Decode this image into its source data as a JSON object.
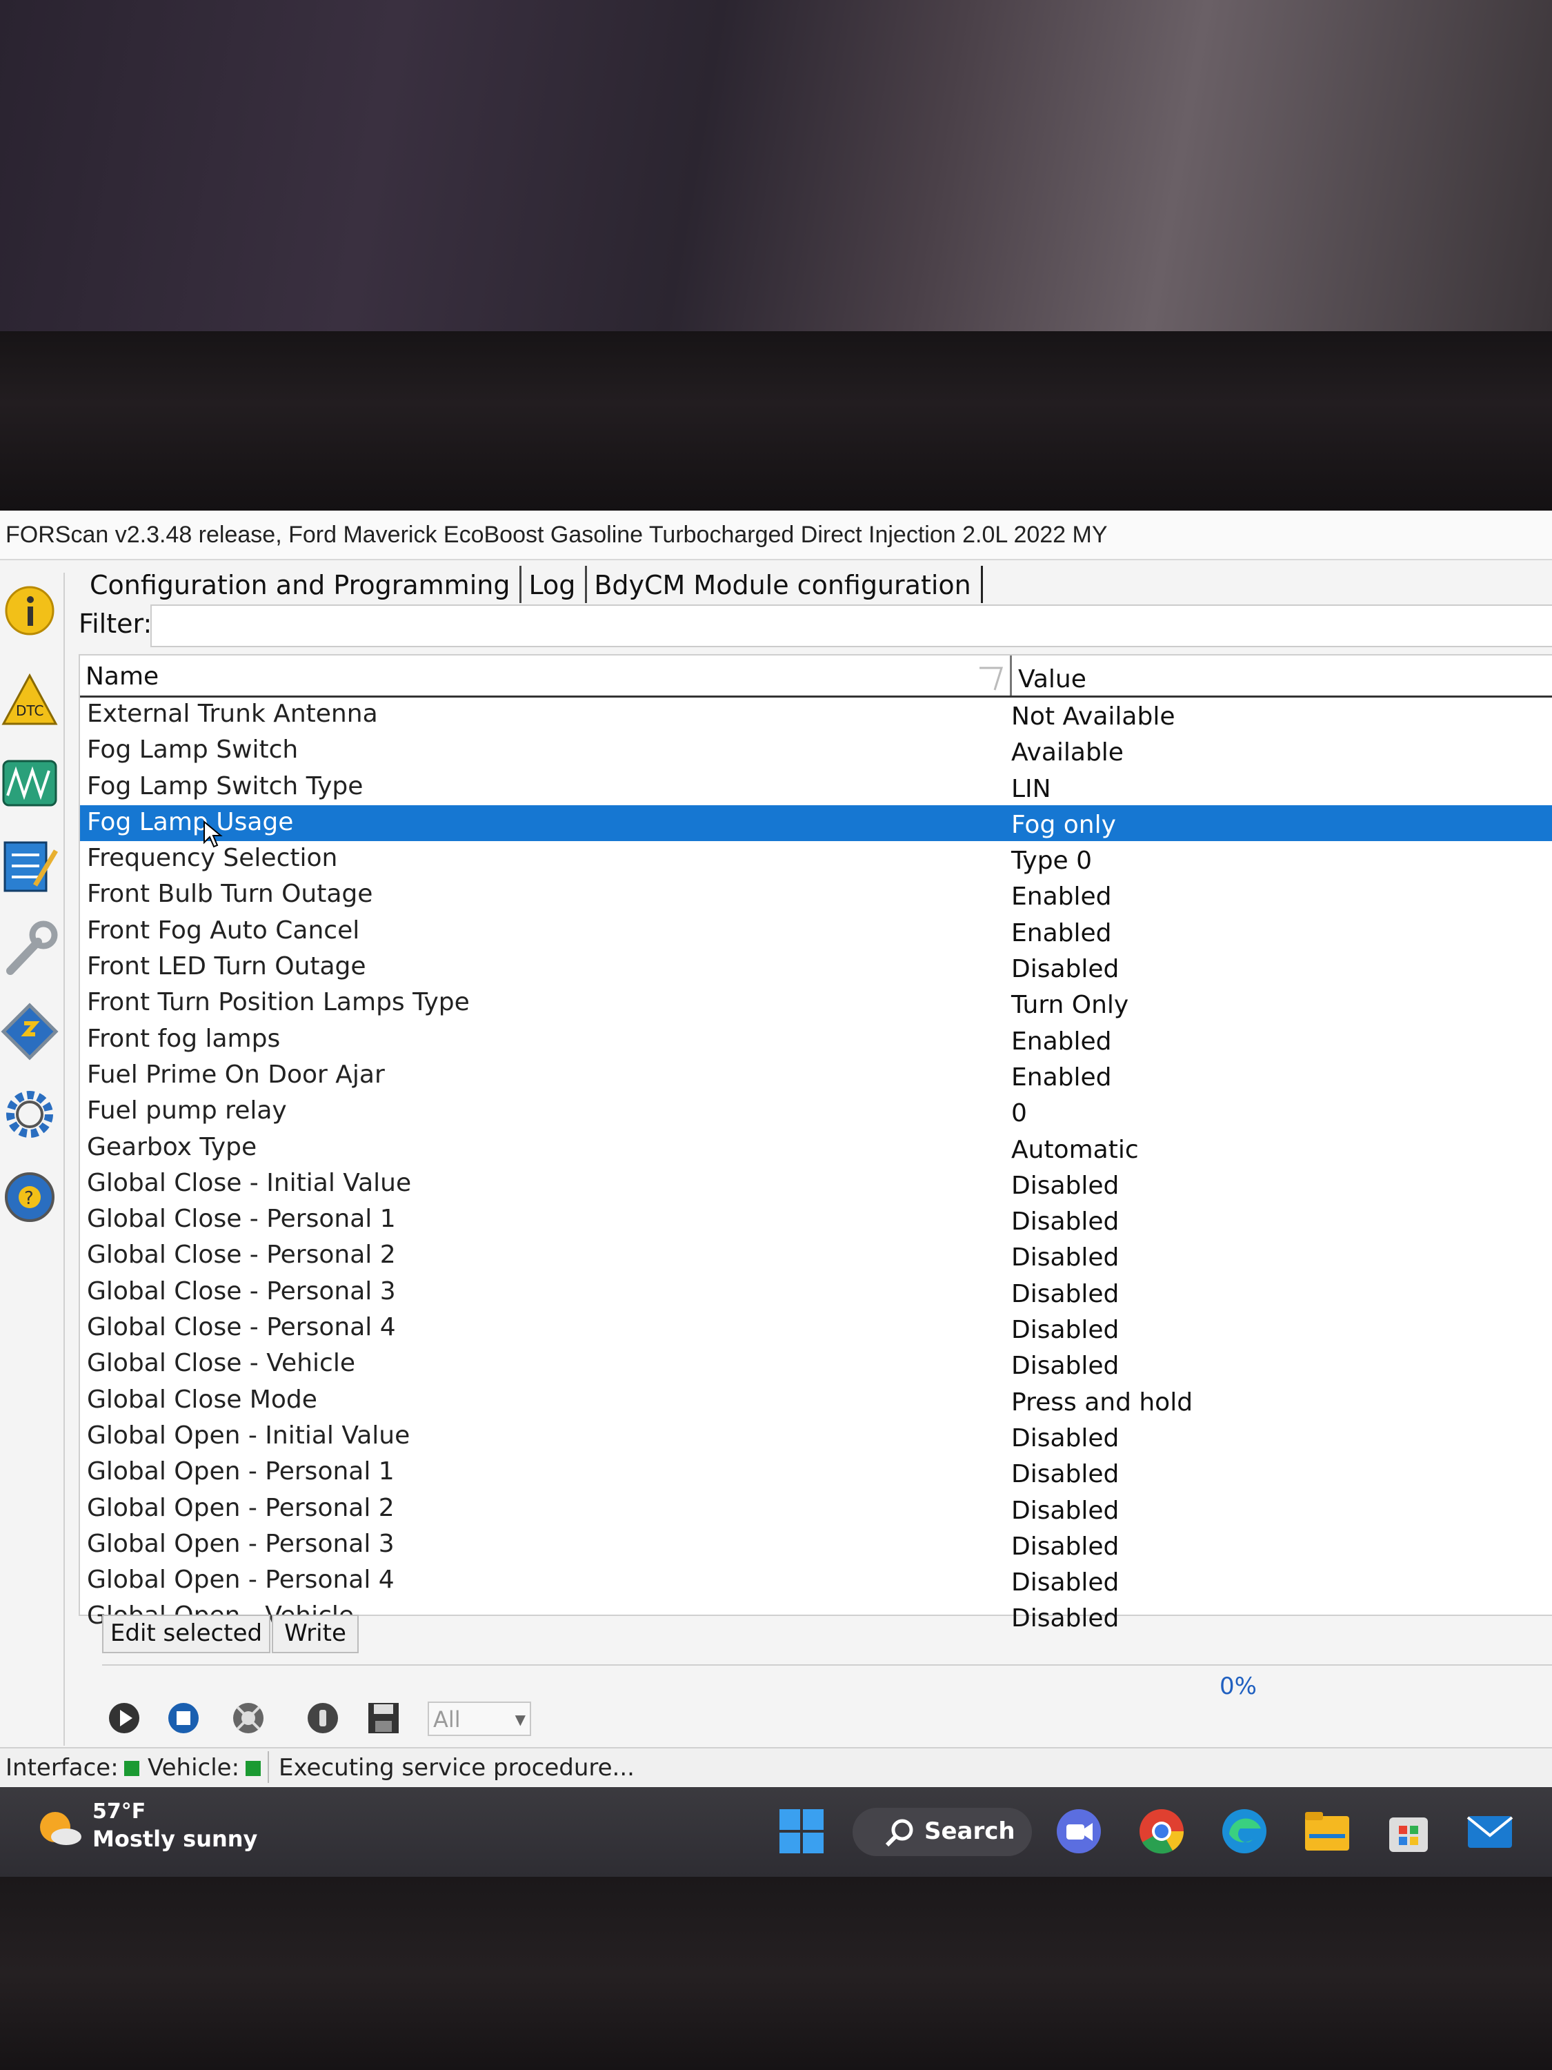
{
  "window": {
    "title": "FORScan v2.3.48 release, Ford Maverick EcoBoost Gasoline Turbocharged Direct Injection 2.0L 2022 MY"
  },
  "sidebar": {
    "items": [
      {
        "name": "info-icon"
      },
      {
        "name": "dtc-icon",
        "label": "DTC"
      },
      {
        "name": "oscilloscope-icon"
      },
      {
        "name": "checklist-icon"
      },
      {
        "name": "wrench-icon"
      },
      {
        "name": "module-chip-icon"
      },
      {
        "name": "gear-icon"
      },
      {
        "name": "help-icon",
        "label": "?"
      }
    ]
  },
  "tabs": [
    {
      "label": "Configuration and Programming"
    },
    {
      "label": "Log"
    },
    {
      "label": "BdyCM Module configuration"
    }
  ],
  "filter": {
    "label": "Filter:",
    "value": ""
  },
  "table": {
    "headers": {
      "name": "Name",
      "value": "Value"
    },
    "selected_index": 3,
    "rows": [
      {
        "name": "External Trunk Antenna",
        "value": "Not Available"
      },
      {
        "name": "Fog Lamp Switch",
        "value": "Available"
      },
      {
        "name": "Fog Lamp Switch Type",
        "value": "LIN"
      },
      {
        "name": "Fog Lamp Usage",
        "value": "Fog only"
      },
      {
        "name": "Frequency Selection",
        "value": "Type 0"
      },
      {
        "name": "Front Bulb Turn Outage",
        "value": "Enabled"
      },
      {
        "name": "Front Fog Auto Cancel",
        "value": "Enabled"
      },
      {
        "name": "Front LED Turn Outage",
        "value": "Disabled"
      },
      {
        "name": "Front Turn Position Lamps Type",
        "value": "Turn Only"
      },
      {
        "name": "Front fog lamps",
        "value": "Enabled"
      },
      {
        "name": "Fuel Prime On Door Ajar",
        "value": "Enabled"
      },
      {
        "name": "Fuel pump relay",
        "value": "0"
      },
      {
        "name": "Gearbox Type",
        "value": "Automatic"
      },
      {
        "name": "Global Close - Initial Value",
        "value": "Disabled"
      },
      {
        "name": "Global Close - Personal 1",
        "value": "Disabled"
      },
      {
        "name": "Global Close - Personal 2",
        "value": "Disabled"
      },
      {
        "name": "Global Close - Personal 3",
        "value": "Disabled"
      },
      {
        "name": "Global Close - Personal 4",
        "value": "Disabled"
      },
      {
        "name": "Global Close - Vehicle",
        "value": "Disabled"
      },
      {
        "name": "Global Close Mode",
        "value": "Press and hold"
      },
      {
        "name": "Global Open - Initial Value",
        "value": "Disabled"
      },
      {
        "name": "Global Open - Personal 1",
        "value": "Disabled"
      },
      {
        "name": "Global Open - Personal 2",
        "value": "Disabled"
      },
      {
        "name": "Global Open - Personal 3",
        "value": "Disabled"
      },
      {
        "name": "Global Open - Personal 4",
        "value": "Disabled"
      },
      {
        "name": "Global Open - Vehicle",
        "value": "Disabled"
      }
    ]
  },
  "actions": {
    "edit_label": "Edit selected",
    "write_label": "Write"
  },
  "progress": {
    "text": "0%",
    "value": 0
  },
  "toolbar": {
    "icons": [
      "play-icon",
      "stop-icon",
      "reset-icon",
      "info-icon",
      "save-icon"
    ],
    "select_value": "All"
  },
  "status": {
    "interface_label": "Interface:",
    "vehicle_label": "Vehicle:",
    "message": "Executing service procedure...",
    "led_color": "#1b9a32"
  },
  "taskbar": {
    "weather_temp": "57°F",
    "weather_desc": "Mostly sunny",
    "search_label": "Search",
    "apps": [
      "windows-start-icon",
      "search-icon",
      "meet-icon",
      "chrome-icon",
      "edge-icon",
      "file-explorer-icon",
      "store-icon",
      "mail-icon"
    ]
  },
  "colors": {
    "selection": "#1677d2",
    "accent": "#1677d2"
  }
}
